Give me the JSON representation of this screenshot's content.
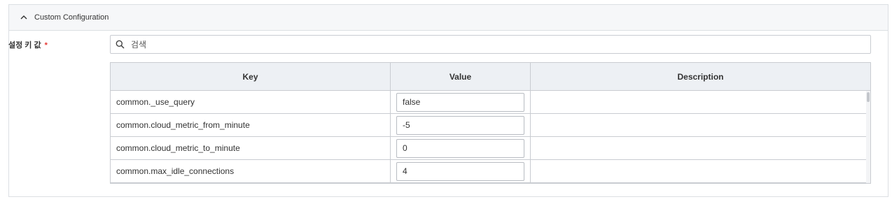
{
  "panel": {
    "title": "Custom Configuration",
    "toggle_icon": "chevron-up-icon"
  },
  "field": {
    "label": "설정 키 값",
    "required_mark": "*"
  },
  "search": {
    "placeholder": "검색",
    "icon": "search-icon"
  },
  "table": {
    "headers": {
      "key": "Key",
      "value": "Value",
      "description": "Description"
    },
    "rows": [
      {
        "key": "common._use_query",
        "value": "false",
        "description": ""
      },
      {
        "key": "common.cloud_metric_from_minute",
        "value": "-5",
        "description": ""
      },
      {
        "key": "common.cloud_metric_to_minute",
        "value": "0",
        "description": ""
      },
      {
        "key": "common.max_idle_connections",
        "value": "4",
        "description": ""
      }
    ]
  },
  "colors": {
    "header_bg": "#f6f7f9",
    "table_header_bg": "#edf0f4",
    "border": "#c9ccd1",
    "required": "#e53935"
  }
}
